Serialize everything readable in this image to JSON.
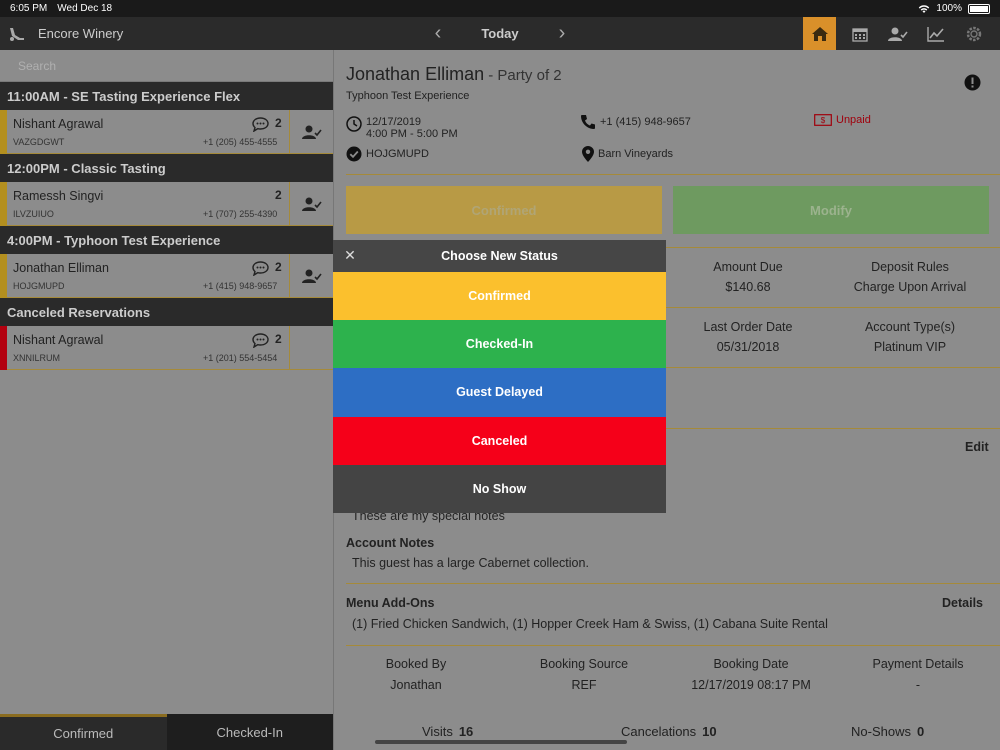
{
  "statusbar": {
    "time": "6:05 PM",
    "date": "Wed Dec 18",
    "battery": "100%"
  },
  "nav": {
    "brand": "Encore Winery",
    "title": "Today"
  },
  "search": {
    "placeholder": "Search"
  },
  "groups": [
    {
      "header": "11:00AM - SE  Tasting Experience Flex",
      "name": "Nishant Agrawal",
      "code": "VAZGDGWT",
      "phone": "+1 (205) 455-4555",
      "count": "2"
    },
    {
      "header": "12:00PM - Classic Tasting",
      "name": "Ramessh Singvi",
      "code": "ILVZUIUO",
      "phone": "+1 (707) 255-4390",
      "count": "2"
    },
    {
      "header": "4:00PM - Typhoon Test Experience",
      "name": "Jonathan Elliman",
      "code": "HOJGMUPD",
      "phone": "+1 (415) 948-9657",
      "count": "2"
    },
    {
      "header": "Canceled Reservations",
      "name": "Nishant Agrawal",
      "code": "XNNILRUM",
      "phone": "+1 (201) 554-5454",
      "count": "2"
    }
  ],
  "bottom_tabs": {
    "confirmed": "Confirmed",
    "checked_in": "Checked-In"
  },
  "detail": {
    "guest_name": "Jonathan Elliman",
    "party": " - Party of 2",
    "experience": "Typhoon Test Experience",
    "date": "12/17/2019",
    "time": "4:00 PM - 5:00 PM",
    "code": "HOJGMUPD",
    "phone": "+1 (415) 948-9657",
    "location": "Barn Vineyards",
    "payment_status": "Unpaid",
    "btn_confirmed": "Confirmed",
    "btn_modify": "Modify",
    "amount_due_label": "Amount Due",
    "amount_due": "$140.68",
    "deposit_label": "Deposit Rules",
    "deposit": "Charge Upon Arrival",
    "last_order_label": "Last Order Date",
    "last_order": "05/31/2018",
    "account_type_label": "Account Type(s)",
    "account_type": "Platinum VIP",
    "edit": "Edit",
    "special_notes": "These are my special notes",
    "account_notes_title": "Account Notes",
    "account_notes": "This guest has a large Cabernet collection.",
    "addons_title": "Menu Add-Ons",
    "addons_details": "Details",
    "addons": "(1) Fried Chicken Sandwich, (1) Hopper Creek Ham & Swiss, (1) Cabana Suite Rental",
    "booked_by_label": "Booked By",
    "booked_by": "Jonathan",
    "source_label": "Booking Source",
    "source": "REF",
    "booking_date_label": "Booking Date",
    "booking_date": "12/17/2019 08:17 PM",
    "payment_label": "Payment Details",
    "payment": "-",
    "visits_label": "Visits",
    "visits": "16",
    "cancels_label": "Cancelations",
    "cancels": "10",
    "noshows_label": "No-Shows",
    "noshows": "0"
  },
  "modal": {
    "title": "Choose New Status",
    "options": [
      {
        "label": "Confirmed",
        "color": "#fbc02d"
      },
      {
        "label": "Checked-In",
        "color": "#2db24d"
      },
      {
        "label": "Guest Delayed",
        "color": "#2d6ec4"
      },
      {
        "label": "Canceled",
        "color": "#f50019"
      },
      {
        "label": "No Show",
        "color": "#444444"
      }
    ]
  },
  "colors": {
    "accent": "#d9902a",
    "unpaid": "#a0000c"
  }
}
